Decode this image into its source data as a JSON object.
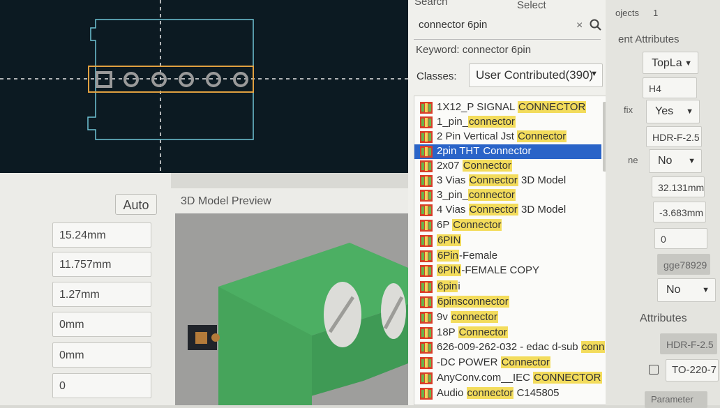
{
  "pcb": {},
  "properties": {
    "auto_label": "Auto",
    "fields": [
      "15.24mm",
      "11.757mm",
      "1.27mm",
      "0mm",
      "0mm",
      "0"
    ]
  },
  "preview": {
    "title": "3D Model Preview"
  },
  "search": {
    "tab_search": "Search",
    "tab_select": "Select",
    "query": "connector 6pin",
    "keyword_text": "Keyword: connector 6pin",
    "classes_label": "Classes:",
    "classes_value": "User Contributed(390)",
    "results": [
      {
        "pre": "1X12_P SIGNAL ",
        "hl": "CONNECTOR",
        "post": ""
      },
      {
        "pre": "1_pin_",
        "hl": "connector",
        "post": ""
      },
      {
        "pre": "2 Pin Vertical Jst ",
        "hl": "Connector",
        "post": ""
      },
      {
        "pre": "2pin THT ",
        "hl": "Connector",
        "post": "",
        "selected": true
      },
      {
        "pre": "2x07 ",
        "hl": "Connector",
        "post": ""
      },
      {
        "pre": "3 Vias ",
        "hl": "Connector",
        "post": " 3D Model"
      },
      {
        "pre": "3_pin_",
        "hl": "connector",
        "post": ""
      },
      {
        "pre": "4 Vias ",
        "hl": "Connector",
        "post": " 3D Model"
      },
      {
        "pre": "6P ",
        "hl": "Connector",
        "post": ""
      },
      {
        "pre": "",
        "hl": "6PIN",
        "post": ""
      },
      {
        "pre": "",
        "hl": "6Pin",
        "post": "-Female"
      },
      {
        "pre": "",
        "hl": "6PIN",
        "post": "-FEMALE COPY"
      },
      {
        "pre": "",
        "hl": "6pin",
        "post": "i"
      },
      {
        "pre": "",
        "hl": "6pinsconnector",
        "post": ""
      },
      {
        "pre": "9v ",
        "hl": "connector",
        "post": ""
      },
      {
        "pre": "18P ",
        "hl": "Connector",
        "post": ""
      },
      {
        "pre": "626-009-262-032 - edac d-sub ",
        "hl": "conn",
        "post": ""
      },
      {
        "pre": "-DC POWER ",
        "hl": "Connector",
        "post": ""
      },
      {
        "pre": "AnyConv.com__IEC ",
        "hl": "CONNECTOR",
        "post": ""
      },
      {
        "pre": "Audio ",
        "hl": "connector",
        "post": " C145805"
      }
    ]
  },
  "right_panel": {
    "objects_label": "ojects",
    "objects_count": "1",
    "attributes_header": "ent Attributes",
    "layer_value": "TopLa",
    "designator": "H4",
    "fix_label": "fix",
    "fix_value": "Yes",
    "footprint": "HDR-F-2.5",
    "ne_label": "ne",
    "ne_value": "No",
    "x_value": "32.131mm",
    "y_value": "-3.683mm",
    "rotation": "0",
    "id_value": "gge78929",
    "no_value": "No",
    "attributes_label": "Attributes",
    "footprint2": "HDR-F-2.5",
    "package": "TO-220-7",
    "parameter_label": "Parameter"
  }
}
